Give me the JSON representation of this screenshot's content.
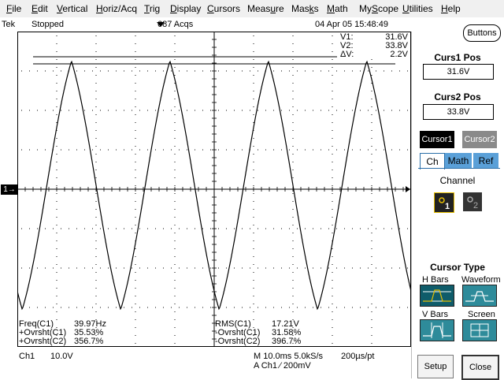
{
  "menu": {
    "items": [
      {
        "pre": "",
        "u": "F",
        "post": "ile"
      },
      {
        "pre": "",
        "u": "E",
        "post": "dit"
      },
      {
        "pre": "",
        "u": "V",
        "post": "ertical"
      },
      {
        "pre": "",
        "u": "H",
        "post": "oriz/Acq"
      },
      {
        "pre": "",
        "u": "T",
        "post": "rig"
      },
      {
        "pre": "",
        "u": "D",
        "post": "isplay"
      },
      {
        "pre": "",
        "u": "C",
        "post": "ursors"
      },
      {
        "pre": "Meas",
        "u": "u",
        "post": "re"
      },
      {
        "pre": "Mas",
        "u": "k",
        "post": "s"
      },
      {
        "pre": "",
        "u": "M",
        "post": "ath"
      },
      {
        "pre": "My",
        "u": "S",
        "post": "cope"
      },
      {
        "pre": "",
        "u": "U",
        "post": "tilities"
      },
      {
        "pre": "",
        "u": "H",
        "post": "elp"
      }
    ]
  },
  "status": {
    "brand": "Tek",
    "state": "Stopped",
    "acqs": "687 Acqs",
    "datetime": "04 Apr 05 15:48:49"
  },
  "buttons_label": "Buttons",
  "readout": {
    "v1_label": "V1:",
    "v1_value": "31.6V",
    "v2_label": "V2:",
    "v2_value": "33.8V",
    "dv_label": "ΔV:",
    "dv_value": "2.2V"
  },
  "channel_marker": "1→",
  "measurements_left": [
    {
      "label": "Freq(C1)",
      "value": "39.97Hz"
    },
    {
      "label": "+Ovrsht(C1)",
      "value": "35.53%"
    },
    {
      "label": "+Ovrsht(C2)",
      "value": "356.7%"
    }
  ],
  "measurements_right": [
    {
      "label": "RMS(C1)",
      "value": "17.21V"
    },
    {
      "label": "-Ovrsht(C1)",
      "value": "31.58%"
    },
    {
      "label": "-Ovrsht(C2)",
      "value": "396.7%"
    }
  ],
  "bottom": {
    "ch1": "Ch1",
    "ch1_scale": "10.0V",
    "timebase": "M 10.0ms 5.0kS/s",
    "res": "200µs/pt",
    "trigger": "A  Ch1  ⁄  200mV"
  },
  "panel": {
    "cursor1_title": "Curs1 Pos",
    "cursor1_value": "31.6V",
    "cursor2_title": "Curs2 Pos",
    "cursor2_value": "33.8V",
    "cursor1_btn": "Cursor1",
    "cursor2_btn": "Cursor2",
    "tab_ch": "Ch",
    "tab_math": "Math",
    "tab_ref": "Ref",
    "channel_label": "Channel",
    "ch1_btn": "1",
    "ch2_btn": "2",
    "cursor_type_title": "Cursor Type",
    "hbars": "H Bars",
    "waveform": "Waveform",
    "vbars": "V Bars",
    "screen": "Screen",
    "setup": "Setup",
    "close": "Close"
  },
  "colors": {
    "cursor1_bg": "#000000",
    "cursor2_bg": "#8a8a8a",
    "tab_active": "#ffffff",
    "tab_inactive": "#5aa0d8",
    "icon_teal": "#2e8b9a"
  },
  "waveform": {
    "period_divs": 2.5,
    "amplitude_divs": 3.15,
    "offset_divs": 0.1,
    "phase_divs": 0.75
  }
}
